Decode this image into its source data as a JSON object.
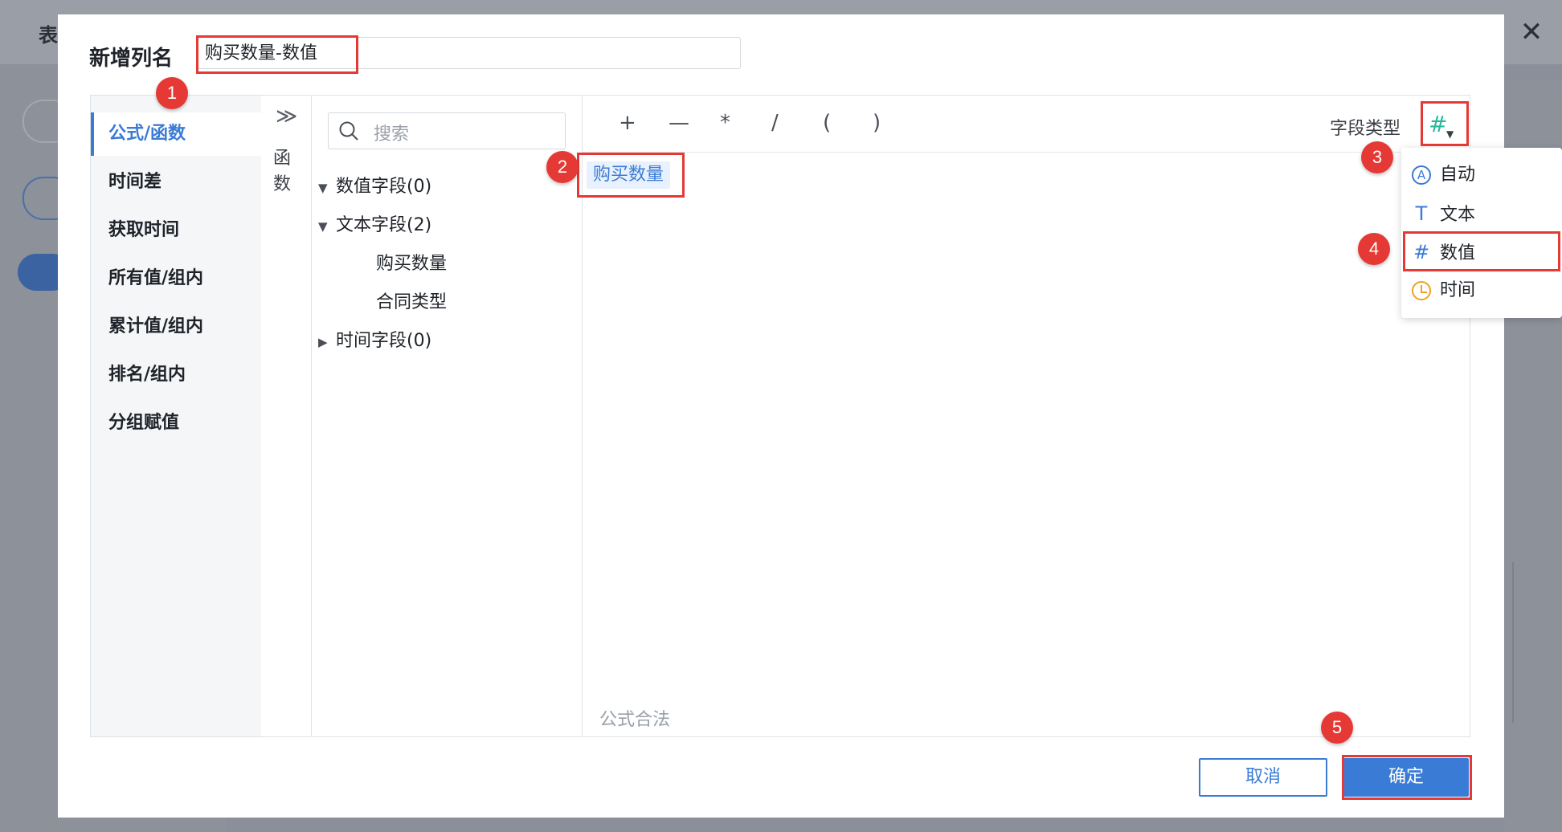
{
  "background": {
    "title": "表",
    "close_icon": "✕"
  },
  "dialog": {
    "title": "新增列名",
    "name_value": "购买数量-数值",
    "categories": [
      {
        "label": "公式/函数"
      },
      {
        "label": "时间差"
      },
      {
        "label": "获取时间"
      },
      {
        "label": "所有值/组内"
      },
      {
        "label": "累计值/组内"
      },
      {
        "label": "排名/组内"
      },
      {
        "label": "分组赋值"
      }
    ],
    "function_tab": {
      "arrows": "≫",
      "label_1": "函",
      "label_2": "数"
    },
    "search": {
      "placeholder": "搜索"
    },
    "tree": {
      "numeric_fields": "数值字段(0)",
      "text_fields": "文本字段(2)",
      "text_children": [
        "购买数量",
        "合同类型"
      ],
      "time_fields": "时间字段(0)"
    },
    "operators": [
      "+",
      "—",
      "*",
      "/",
      "(",
      ")"
    ],
    "field_type_label": "字段类型",
    "field_type_symbol": "#",
    "formula_chip": "购买数量",
    "formula_status": "公式合法",
    "type_options": [
      {
        "icon": "auto-icon",
        "glyph": "A",
        "label": "自动"
      },
      {
        "icon": "text-type-icon",
        "glyph": "T",
        "label": "文本"
      },
      {
        "icon": "number-type-icon",
        "glyph": "#",
        "label": "数值"
      },
      {
        "icon": "clock-icon",
        "glyph": "",
        "label": "时间"
      }
    ],
    "buttons": {
      "cancel": "取消",
      "ok": "确定"
    }
  },
  "annotations": [
    "1",
    "2",
    "3",
    "4",
    "5"
  ],
  "colors": {
    "accent": "#3a7bd5",
    "annotation": "#e53935",
    "number_icon": "#28b99b",
    "time_icon": "#f0a020"
  }
}
